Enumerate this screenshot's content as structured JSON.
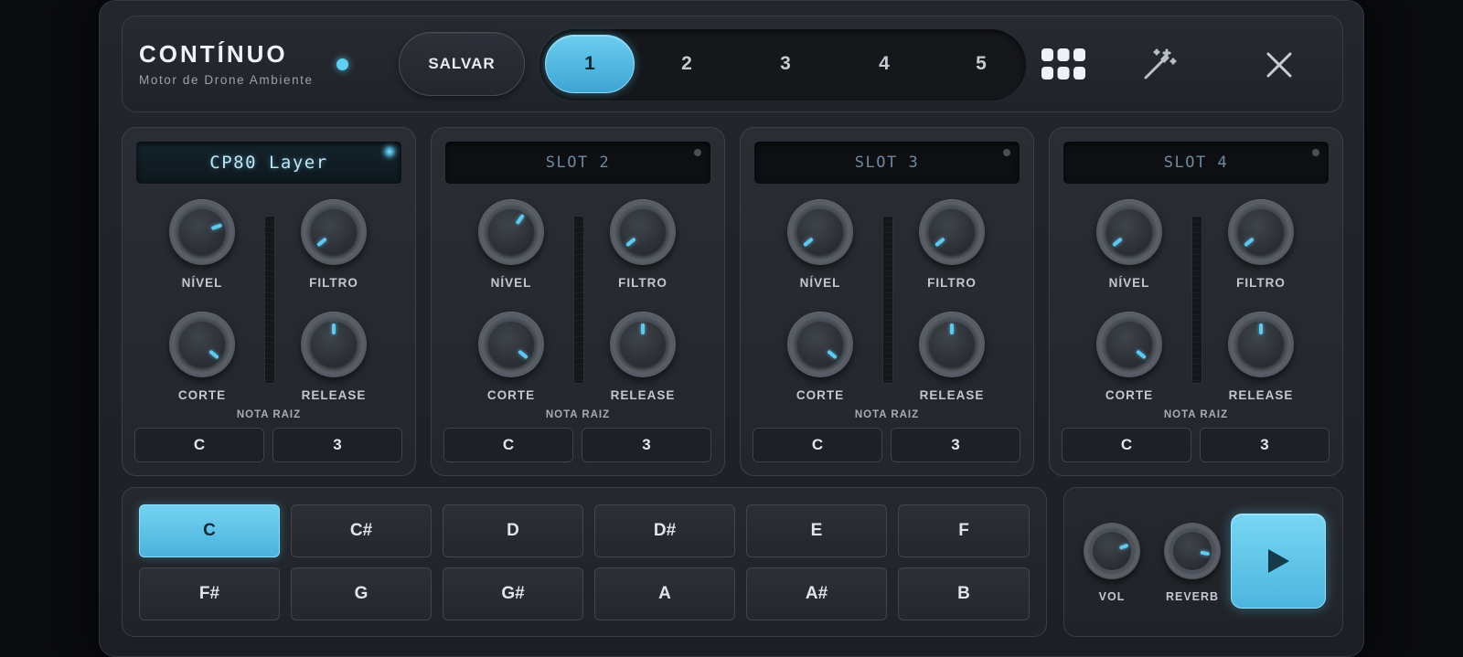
{
  "app": {
    "title": "CONTÍNUO",
    "subtitle": "Motor de Drone Ambiente"
  },
  "header": {
    "save_label": "SALVAR",
    "presets": [
      {
        "label": "1",
        "active": true
      },
      {
        "label": "2",
        "active": false
      },
      {
        "label": "3",
        "active": false
      },
      {
        "label": "4",
        "active": false
      },
      {
        "label": "5",
        "active": false
      }
    ],
    "icons": [
      "grid-icon",
      "magic-wand-icon",
      "close-icon"
    ],
    "accent_color": "#5fcaf0"
  },
  "slots": [
    {
      "name": "CP80 Layer",
      "active": true,
      "knobs": {
        "nivel_label": "NÍVEL",
        "filtro_label": "FILTRO",
        "corte_label": "CORTE",
        "release_label": "RELEASE"
      },
      "knob_angles_deg": {
        "nivel": 70,
        "filtro": -130,
        "corte": 130,
        "release": 0
      },
      "root_label": "NOTA RAIZ",
      "root_note": "C",
      "octave": "3"
    },
    {
      "name": "SLOT 2",
      "active": false,
      "knobs": {
        "nivel_label": "NÍVEL",
        "filtro_label": "FILTRO",
        "corte_label": "CORTE",
        "release_label": "RELEASE"
      },
      "knob_angles_deg": {
        "nivel": 35,
        "filtro": -130,
        "corte": 130,
        "release": 0
      },
      "root_label": "NOTA RAIZ",
      "root_note": "C",
      "octave": "3"
    },
    {
      "name": "SLOT 3",
      "active": false,
      "knobs": {
        "nivel_label": "NÍVEL",
        "filtro_label": "FILTRO",
        "corte_label": "CORTE",
        "release_label": "RELEASE"
      },
      "knob_angles_deg": {
        "nivel": -130,
        "filtro": -130,
        "corte": 130,
        "release": 0
      },
      "root_label": "NOTA RAIZ",
      "root_note": "C",
      "octave": "3"
    },
    {
      "name": "SLOT 4",
      "active": false,
      "knobs": {
        "nivel_label": "NÍVEL",
        "filtro_label": "FILTRO",
        "corte_label": "CORTE",
        "release_label": "RELEASE"
      },
      "knob_angles_deg": {
        "nivel": -130,
        "filtro": -130,
        "corte": 130,
        "release": 0
      },
      "root_label": "NOTA RAIZ",
      "root_note": "C",
      "octave": "3"
    }
  ],
  "notes": {
    "selected": "C",
    "rows": [
      [
        "C",
        "C#",
        "D",
        "D#",
        "E",
        "F"
      ],
      [
        "F#",
        "G",
        "G#",
        "A",
        "A#",
        "B"
      ]
    ]
  },
  "master": {
    "vol_label": "VOL",
    "reverb_label": "REVERB",
    "vol_angle_deg": 70,
    "reverb_angle_deg": 100,
    "play_icon": "play-icon"
  }
}
